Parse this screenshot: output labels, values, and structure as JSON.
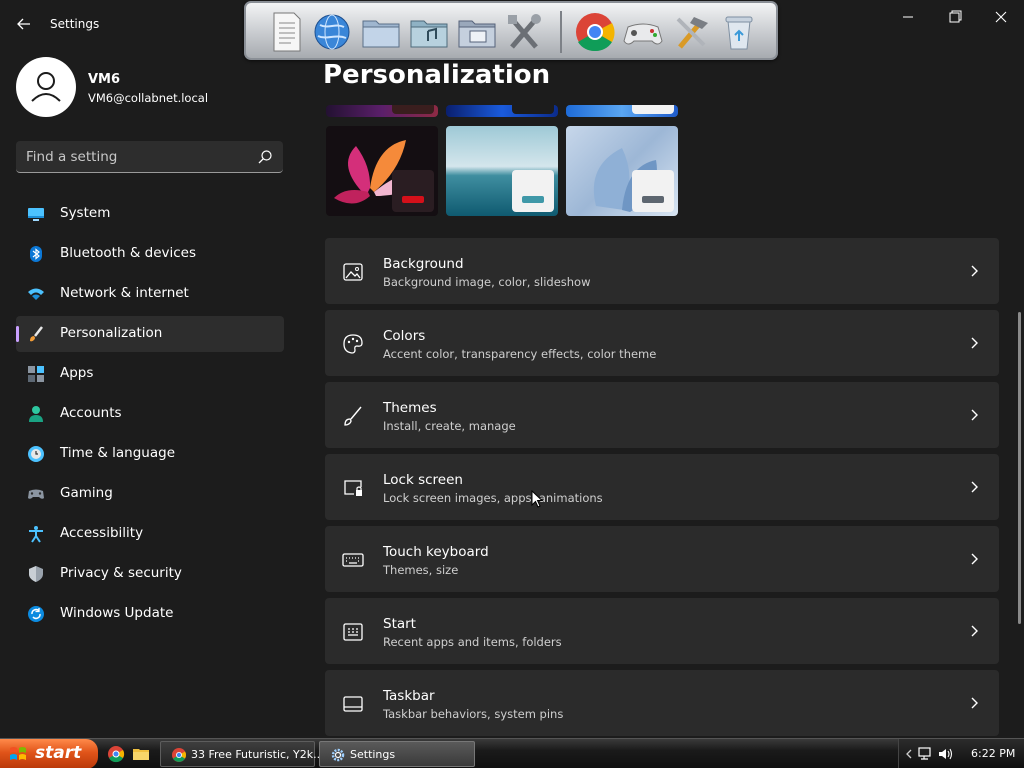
{
  "window": {
    "app_title": "Settings"
  },
  "profile": {
    "name": "VM6",
    "email": "VM6@collabnet.local"
  },
  "search": {
    "placeholder": "Find a setting"
  },
  "nav": {
    "items": [
      {
        "label": "System",
        "icon": "monitor-icon"
      },
      {
        "label": "Bluetooth & devices",
        "icon": "bluetooth-icon"
      },
      {
        "label": "Network & internet",
        "icon": "wifi-icon"
      },
      {
        "label": "Personalization",
        "icon": "brush-icon",
        "active": true
      },
      {
        "label": "Apps",
        "icon": "apps-icon"
      },
      {
        "label": "Accounts",
        "icon": "person-icon"
      },
      {
        "label": "Time & language",
        "icon": "globe-clock-icon"
      },
      {
        "label": "Gaming",
        "icon": "gamepad-icon"
      },
      {
        "label": "Accessibility",
        "icon": "accessibility-icon"
      },
      {
        "label": "Privacy & security",
        "icon": "shield-icon"
      },
      {
        "label": "Windows Update",
        "icon": "update-icon"
      }
    ]
  },
  "page": {
    "title": "Personalization"
  },
  "cards": [
    {
      "title": "Background",
      "subtitle": "Background image, color, slideshow",
      "icon": "picture-icon"
    },
    {
      "title": "Colors",
      "subtitle": "Accent color, transparency effects, color theme",
      "icon": "palette-icon"
    },
    {
      "title": "Themes",
      "subtitle": "Install, create, manage",
      "icon": "brush-icon"
    },
    {
      "title": "Lock screen",
      "subtitle": "Lock screen images, apps, animations",
      "icon": "lock-screen-icon"
    },
    {
      "title": "Touch keyboard",
      "subtitle": "Themes, size",
      "icon": "keyboard-icon"
    },
    {
      "title": "Start",
      "subtitle": "Recent apps and items, folders",
      "icon": "start-icon"
    },
    {
      "title": "Taskbar",
      "subtitle": "Taskbar behaviors, system pins",
      "icon": "taskbar-icon"
    }
  ],
  "taskbar": {
    "start_label": "start",
    "buttons": [
      {
        "label": "33 Free Futuristic, Y2k...",
        "icon": "chrome-icon"
      },
      {
        "label": "Settings",
        "icon": "gear-icon",
        "active": true
      }
    ],
    "clock": "6:22 PM"
  },
  "colors": {
    "accent": "#c9a0ff",
    "card_bg": "#2b2b2b",
    "window_bg": "#1c1c1c",
    "start_button": "#e05419"
  }
}
